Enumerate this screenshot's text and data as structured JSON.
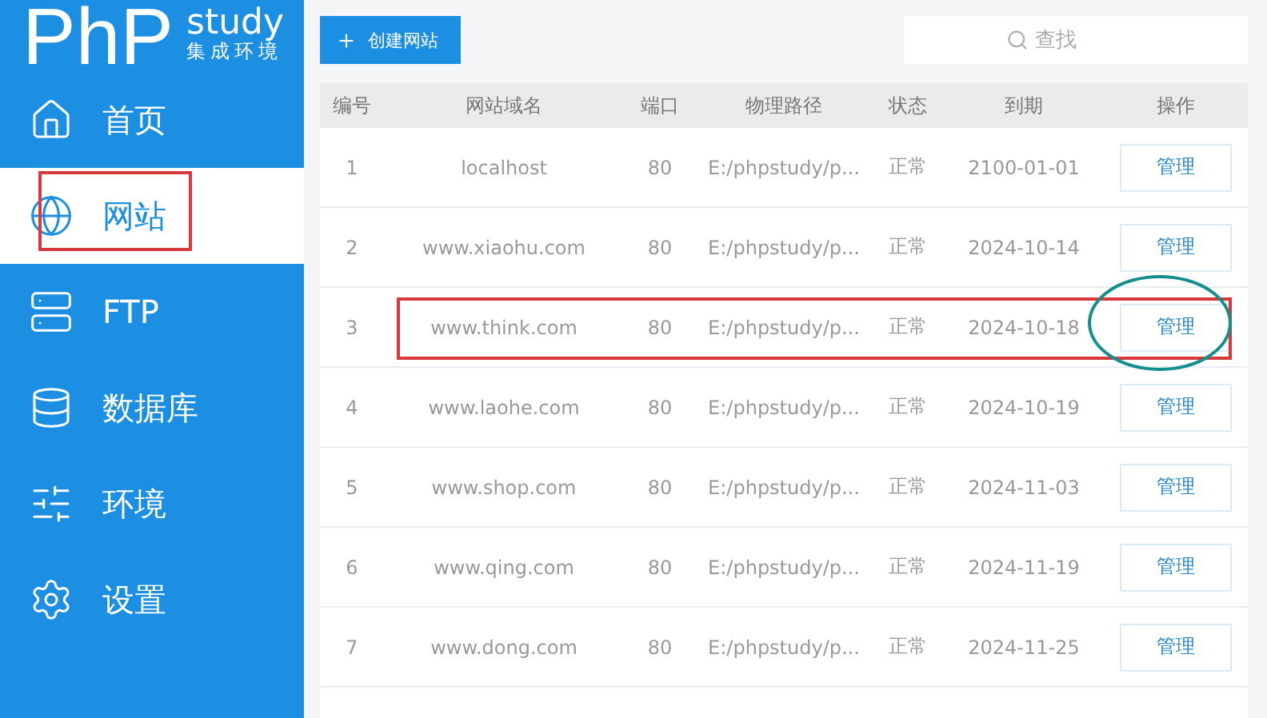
{
  "logo": {
    "title": "PhP",
    "subtitle": "study",
    "tagline": "集成环境"
  },
  "sidebar": {
    "items": [
      {
        "label": "首页",
        "selected": false,
        "annotated": false
      },
      {
        "label": "网站",
        "selected": true,
        "annotated": true
      },
      {
        "label": "FTP",
        "selected": false,
        "annotated": false
      },
      {
        "label": "数据库",
        "selected": false,
        "annotated": false
      },
      {
        "label": "环境",
        "selected": false,
        "annotated": false
      },
      {
        "label": "设置",
        "selected": false,
        "annotated": false
      }
    ]
  },
  "toolbar": {
    "create_button": "创建网站",
    "search": {
      "placeholder": "查找"
    }
  },
  "table": {
    "columns": [
      "编号",
      "网站域名",
      "端口",
      "物理路径",
      "状态",
      "到期",
      "操作"
    ],
    "rows": [
      {
        "id": "1",
        "domain": "localhost",
        "port": "80",
        "path": "E:/phpstudy/p...",
        "status": "正常",
        "expires": "2100-01-01",
        "action": "管理",
        "annotated": false
      },
      {
        "id": "2",
        "domain": "www.xiaohu.com",
        "port": "80",
        "path": "E:/phpstudy/p...",
        "status": "正常",
        "expires": "2024-10-14",
        "action": "管理",
        "annotated": false
      },
      {
        "id": "3",
        "domain": "www.think.com",
        "port": "80",
        "path": "E:/phpstudy/p...",
        "status": "正常",
        "expires": "2024-10-18",
        "action": "管理",
        "annotated": true
      },
      {
        "id": "4",
        "domain": "www.laohe.com",
        "port": "80",
        "path": "E:/phpstudy/p...",
        "status": "正常",
        "expires": "2024-10-19",
        "action": "管理",
        "annotated": false
      },
      {
        "id": "5",
        "domain": "www.shop.com",
        "port": "80",
        "path": "E:/phpstudy/p...",
        "status": "正常",
        "expires": "2024-11-03",
        "action": "管理",
        "annotated": false
      },
      {
        "id": "6",
        "domain": "www.qing.com",
        "port": "80",
        "path": "E:/phpstudy/p...",
        "status": "正常",
        "expires": "2024-11-19",
        "action": "管理",
        "annotated": false
      },
      {
        "id": "7",
        "domain": "www.dong.com",
        "port": "80",
        "path": "E:/phpstudy/p...",
        "status": "正常",
        "expires": "2024-11-25",
        "action": "管理",
        "annotated": false
      }
    ]
  }
}
